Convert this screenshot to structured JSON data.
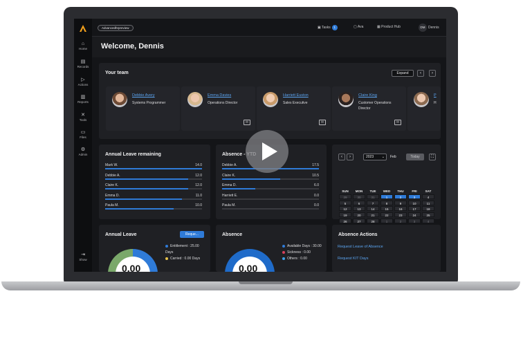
{
  "app": {
    "environment": "Advancedhrpreview",
    "welcome": "Welcome, Dennis"
  },
  "topbar": {
    "tasks_label": "Tasks",
    "tasks_count": "1",
    "ava_label": "Ava",
    "product_hub_label": "Product Hub",
    "user_initials": "DM",
    "user_name": "Dennis"
  },
  "sidebar": {
    "items": [
      {
        "label": "Home",
        "icon": "home-icon"
      },
      {
        "label": "Records",
        "icon": "records-icon"
      },
      {
        "label": "Actions",
        "icon": "play-outline-icon"
      },
      {
        "label": "Reports",
        "icon": "reports-icon"
      },
      {
        "label": "Tools",
        "icon": "tools-icon"
      },
      {
        "label": "Files",
        "icon": "folder-icon"
      },
      {
        "label": "Admin",
        "icon": "admin-icon"
      }
    ],
    "show_label": "Show"
  },
  "team": {
    "title": "Your team",
    "expand_label": "Expand",
    "members": [
      {
        "name": "Debbie Avery",
        "role": "Systems Programmer"
      },
      {
        "name": "Emma Davies",
        "role": "Operations Director"
      },
      {
        "name": "Harriett Euston",
        "role": "Sales Executive"
      },
      {
        "name": "Claire King",
        "role": "Customer Operations Director"
      },
      {
        "name": "P",
        "role": "H"
      }
    ]
  },
  "annual_leave_remaining": {
    "title": "Annual Leave remaining",
    "rows": [
      {
        "name": "Mark W.",
        "value": "14.0",
        "fraction": 1.0
      },
      {
        "name": "Debbie A.",
        "value": "12.0",
        "fraction": 0.86
      },
      {
        "name": "Claire K.",
        "value": "12.0",
        "fraction": 0.86
      },
      {
        "name": "Emma D.",
        "value": "11.0",
        "fraction": 0.79
      },
      {
        "name": "Paula M.",
        "value": "10.0",
        "fraction": 0.71
      }
    ]
  },
  "absence_ytd": {
    "title": "Absence - YTD",
    "rows": [
      {
        "name": "Debbie A.",
        "value": "17.5",
        "fraction": 1.0
      },
      {
        "name": "Claire K.",
        "value": "10.5",
        "fraction": 0.6
      },
      {
        "name": "Emma D.",
        "value": "6.0",
        "fraction": 0.34
      },
      {
        "name": "Harriett E.",
        "value": "0.0",
        "fraction": 0.0
      },
      {
        "name": "Paula M.",
        "value": "0.0",
        "fraction": 0.0
      }
    ]
  },
  "calendar": {
    "year": "2023",
    "month": "Feb",
    "today_label": "Today",
    "days": [
      "SUN",
      "MON",
      "TUE",
      "WED",
      "THU",
      "FRI",
      "SAT"
    ],
    "weeks": [
      [
        "29",
        "30",
        "31",
        "1",
        "2",
        "3",
        "4"
      ],
      [
        "5",
        "6",
        "7",
        "8",
        "9",
        "10",
        "11"
      ],
      [
        "12",
        "13",
        "14",
        "15",
        "16",
        "17",
        "18"
      ],
      [
        "19",
        "20",
        "21",
        "22",
        "23",
        "24",
        "25"
      ],
      [
        "26",
        "27",
        "28",
        "1",
        "2",
        "3",
        "4"
      ],
      [
        "5",
        "6",
        "7",
        "8",
        "9",
        "10",
        "11"
      ]
    ]
  },
  "annual_leave": {
    "title": "Annual Leave",
    "request_label": "Reque...",
    "legend": [
      {
        "label": "Entitlement : 25.00 Days",
        "color": "#2f7bd8"
      },
      {
        "label": "Carried : 0.00 Days",
        "color": "#e7c24a"
      }
    ],
    "center": "0.00"
  },
  "absence": {
    "title": "Absence",
    "legend": [
      {
        "label": "Available Days : 30.00",
        "color": "#2f7bd8"
      },
      {
        "label": "Sickness : 0.00",
        "color": "#d8405a"
      },
      {
        "label": "Others : 0.00",
        "color": "#3aa0e8"
      }
    ],
    "center": "0.00"
  },
  "absence_actions": {
    "title": "Absence Actions",
    "links": [
      "Request Leave of Absence",
      "Request KIT Days"
    ]
  },
  "colors": {
    "accent": "#2f7bd8",
    "brand": "#f2a01c"
  }
}
